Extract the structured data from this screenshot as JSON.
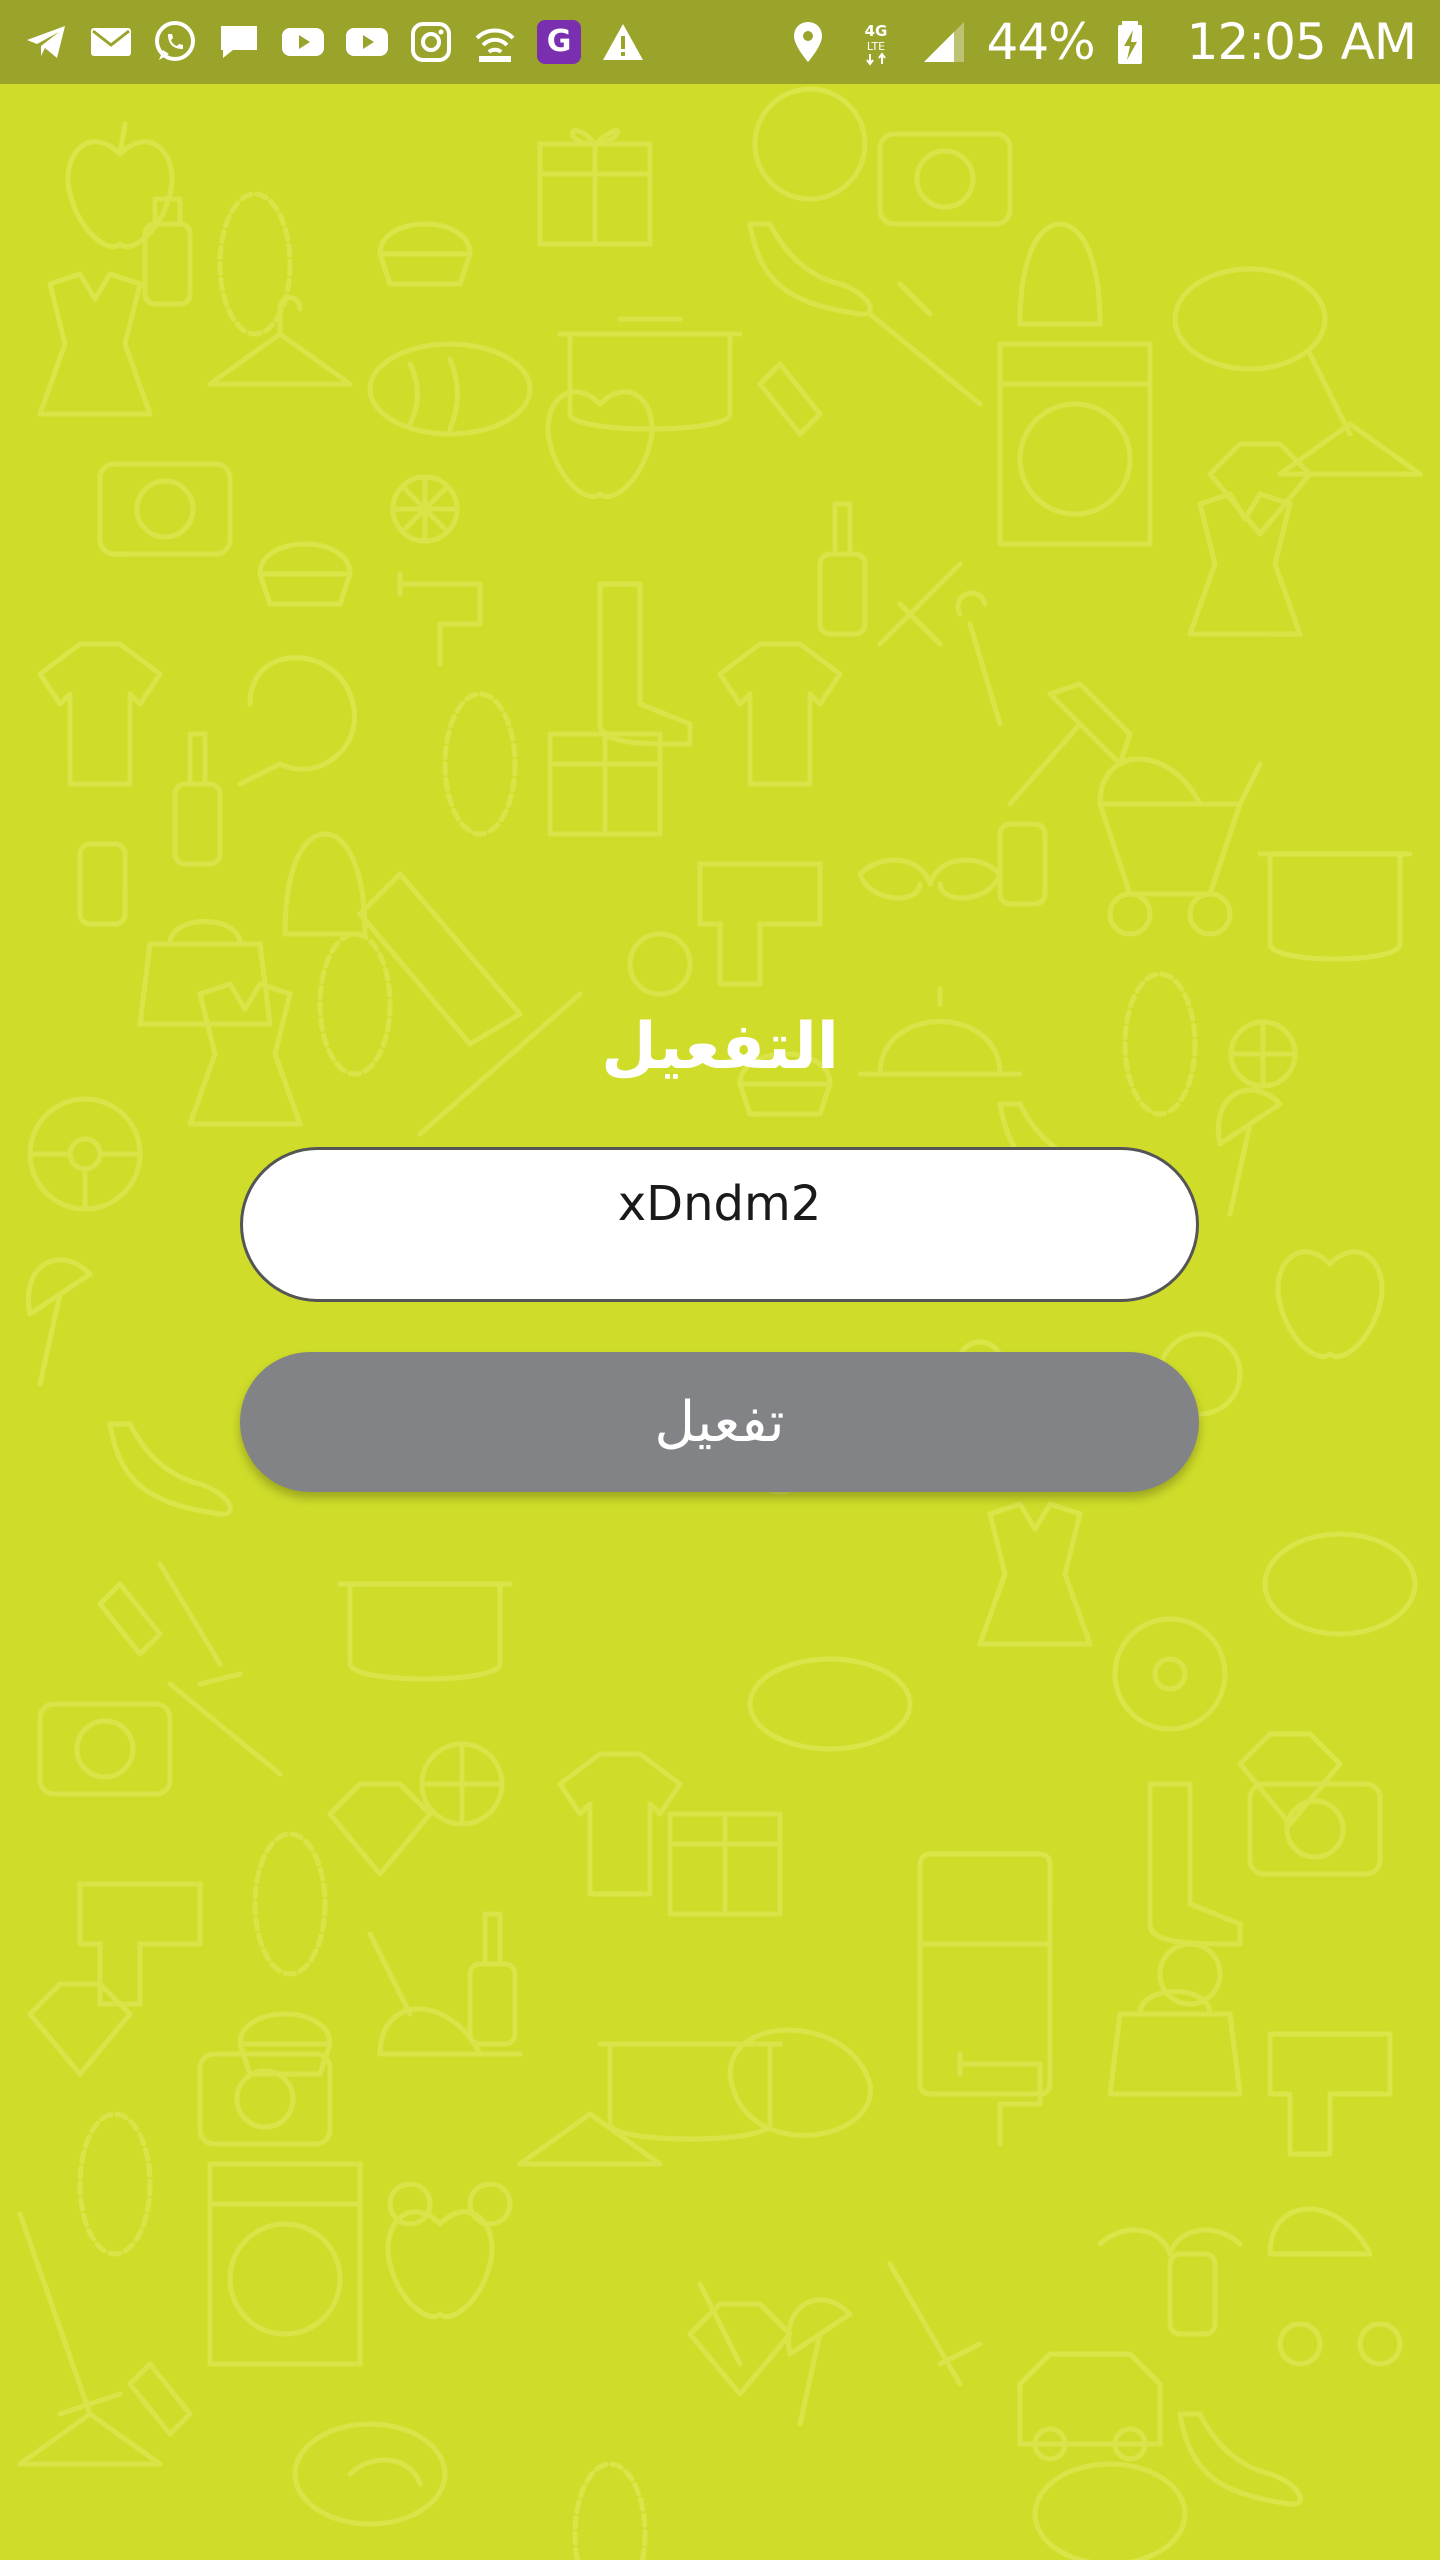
{
  "status_bar": {
    "left_icons": [
      "telegram-icon",
      "email-icon",
      "whatsapp-icon",
      "message-icon",
      "youtube-icon",
      "youtube-icon",
      "instagram-icon",
      "wifi-hotspot-icon",
      "g-app-icon",
      "warning-icon"
    ],
    "right_icons": [
      "location-icon",
      "4g-lte-icon",
      "signal-icon",
      "battery-charging-icon"
    ],
    "battery": "44%",
    "time": "12:05 AM"
  },
  "activation": {
    "title": "التفعيل",
    "code_value": "xDndm2",
    "button_label": "تفعيل"
  },
  "colors": {
    "background": "#cfdd2a",
    "status_bar": "#9ba42a",
    "button": "#828386",
    "input_border": "#555555"
  }
}
